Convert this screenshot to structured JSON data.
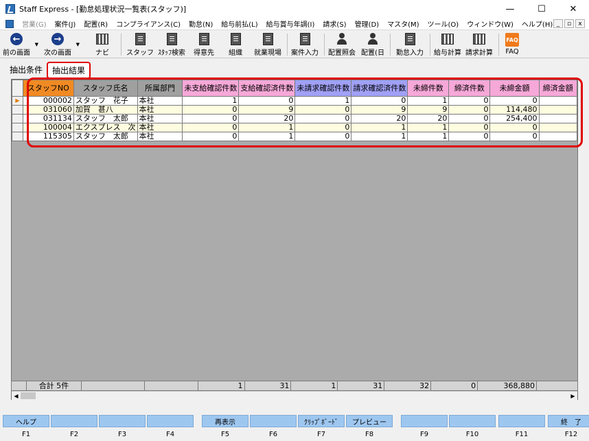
{
  "window": {
    "title": "Staff Express - [勤怠処理状況一覧表(スタッフ)]"
  },
  "window_buttons": [
    "—",
    "☐",
    "✕"
  ],
  "mdi_buttons": [
    "_",
    "▫",
    "x"
  ],
  "menu": [
    {
      "label": "営業(G)",
      "disabled": true
    },
    {
      "label": "案件(J)"
    },
    {
      "label": "配置(R)"
    },
    {
      "label": "コンプライアンス(C)"
    },
    {
      "label": "勤怠(N)"
    },
    {
      "label": "給与前払(L)"
    },
    {
      "label": "給与賞与年調(I)"
    },
    {
      "label": "請求(S)"
    },
    {
      "label": "管理(D)"
    },
    {
      "label": "マスタ(M)"
    },
    {
      "label": "ツール(O)"
    },
    {
      "label": "ウィンドウ(W)"
    },
    {
      "label": "ヘルプ(H)"
    }
  ],
  "toolbar": {
    "prev": "前の画面",
    "next": "次の画面",
    "navi": "ナビ",
    "staff": "スタッフ",
    "staff_search": "ｽﾀｯﾌ検索",
    "client": "得意先",
    "org": "組織",
    "site": "就業現場",
    "case_input": "案件入力",
    "assign_query": "配置照会",
    "assign_day": "配置(日",
    "attendance_input": "勤怠入力",
    "pay_calc": "給与計算",
    "bill_calc": "請求計算",
    "faq": "FAQ",
    "faq_glyph": "FAQ",
    "prev_glyph": "←",
    "next_glyph": "→",
    "dd_glyph": "▼"
  },
  "tabs": {
    "cond": "抽出条件",
    "result": "抽出結果"
  },
  "grid": {
    "headers": [
      "スタッフNO",
      "スタッフ氏名",
      "所属部門",
      "未支給確認件数",
      "支給確認済件数",
      "未請求確認件数",
      "請求確認済件数",
      "未締件数",
      "締済件数",
      "未締金額",
      "締済金額"
    ],
    "header_colors": [
      "#f08a24",
      "#a0a0a0",
      "#a0a0a0",
      "#f6a8d8",
      "#f6a8d8",
      "#a0a0f6",
      "#a0a0f6",
      "#f6a8d8",
      "#f6a8d8",
      "#f6a8d8",
      "#f6a8d8"
    ],
    "current_row_marker": "▶",
    "rows": [
      [
        "000002",
        "スタッフ　花子",
        "本社",
        "1",
        "0",
        "1",
        "0",
        "1",
        "0",
        "0",
        ""
      ],
      [
        "031060",
        "加賀　甚八",
        "本社",
        "0",
        "9",
        "0",
        "9",
        "9",
        "0",
        "114,480",
        ""
      ],
      [
        "031134",
        "スタッフ　太郎",
        "本社",
        "0",
        "20",
        "0",
        "20",
        "20",
        "0",
        "254,400",
        ""
      ],
      [
        "100004",
        "エクスプレス　次",
        "本社",
        "0",
        "1",
        "0",
        "1",
        "1",
        "0",
        "0",
        ""
      ],
      [
        "115305",
        "スタッフ　太郎",
        "本社",
        "0",
        "1",
        "0",
        "1",
        "1",
        "0",
        "0",
        ""
      ]
    ],
    "summary": [
      "合計 5件",
      "",
      "",
      "1",
      "31",
      "1",
      "31",
      "32",
      "0",
      "368,880",
      ""
    ]
  },
  "scroll": {
    "left": "◀",
    "right": "▶"
  },
  "fkeys": [
    {
      "key": "F1",
      "label": "ヘルプ"
    },
    {
      "key": "F2",
      "label": ""
    },
    {
      "key": "F3",
      "label": ""
    },
    {
      "key": "F4",
      "label": ""
    },
    {
      "key": "F5",
      "label": "再表示"
    },
    {
      "key": "F6",
      "label": ""
    },
    {
      "key": "F7",
      "label": "ｸﾘｯﾌﾟﾎﾞｰﾄﾞ"
    },
    {
      "key": "F8",
      "label": "プレビュー"
    },
    {
      "key": "F9",
      "label": ""
    },
    {
      "key": "F10",
      "label": ""
    },
    {
      "key": "F11",
      "label": ""
    },
    {
      "key": "F12",
      "label": "終　了"
    }
  ]
}
